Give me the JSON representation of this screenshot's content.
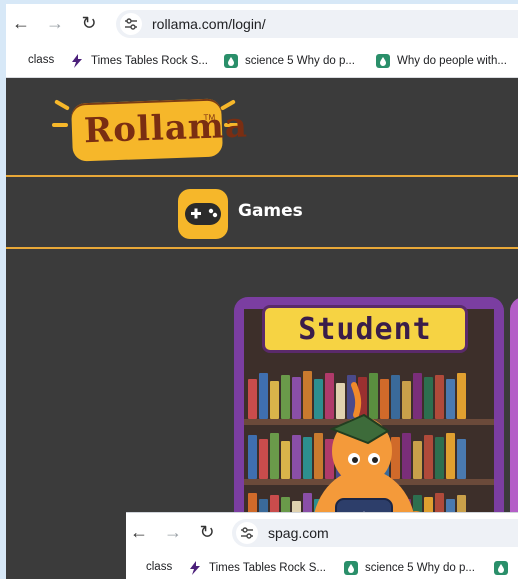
{
  "browser": {
    "url": "rollama.com/login/",
    "bookmarks": [
      {
        "label": "class",
        "icon": ""
      },
      {
        "label": "Times Tables Rock S...",
        "icon": "lightning-icon"
      },
      {
        "label": "science 5 Why do p...",
        "icon": "drop-icon"
      },
      {
        "label": "Why do people with...",
        "icon": "drop-icon"
      }
    ]
  },
  "page": {
    "logo": "Rollama",
    "logo_tm": "TM",
    "nav": {
      "games_label": "Games"
    },
    "card": {
      "title": "Student"
    }
  },
  "window2": {
    "url": "spag.com",
    "bookmarks": [
      {
        "label": "class"
      },
      {
        "label": "Times Tables Rock S..."
      },
      {
        "label": "science 5 Why do p..."
      }
    ]
  },
  "colors": {
    "page_bg": "#3b3b3b",
    "accent": "#f6b72a",
    "card": "#7b3ea1"
  }
}
